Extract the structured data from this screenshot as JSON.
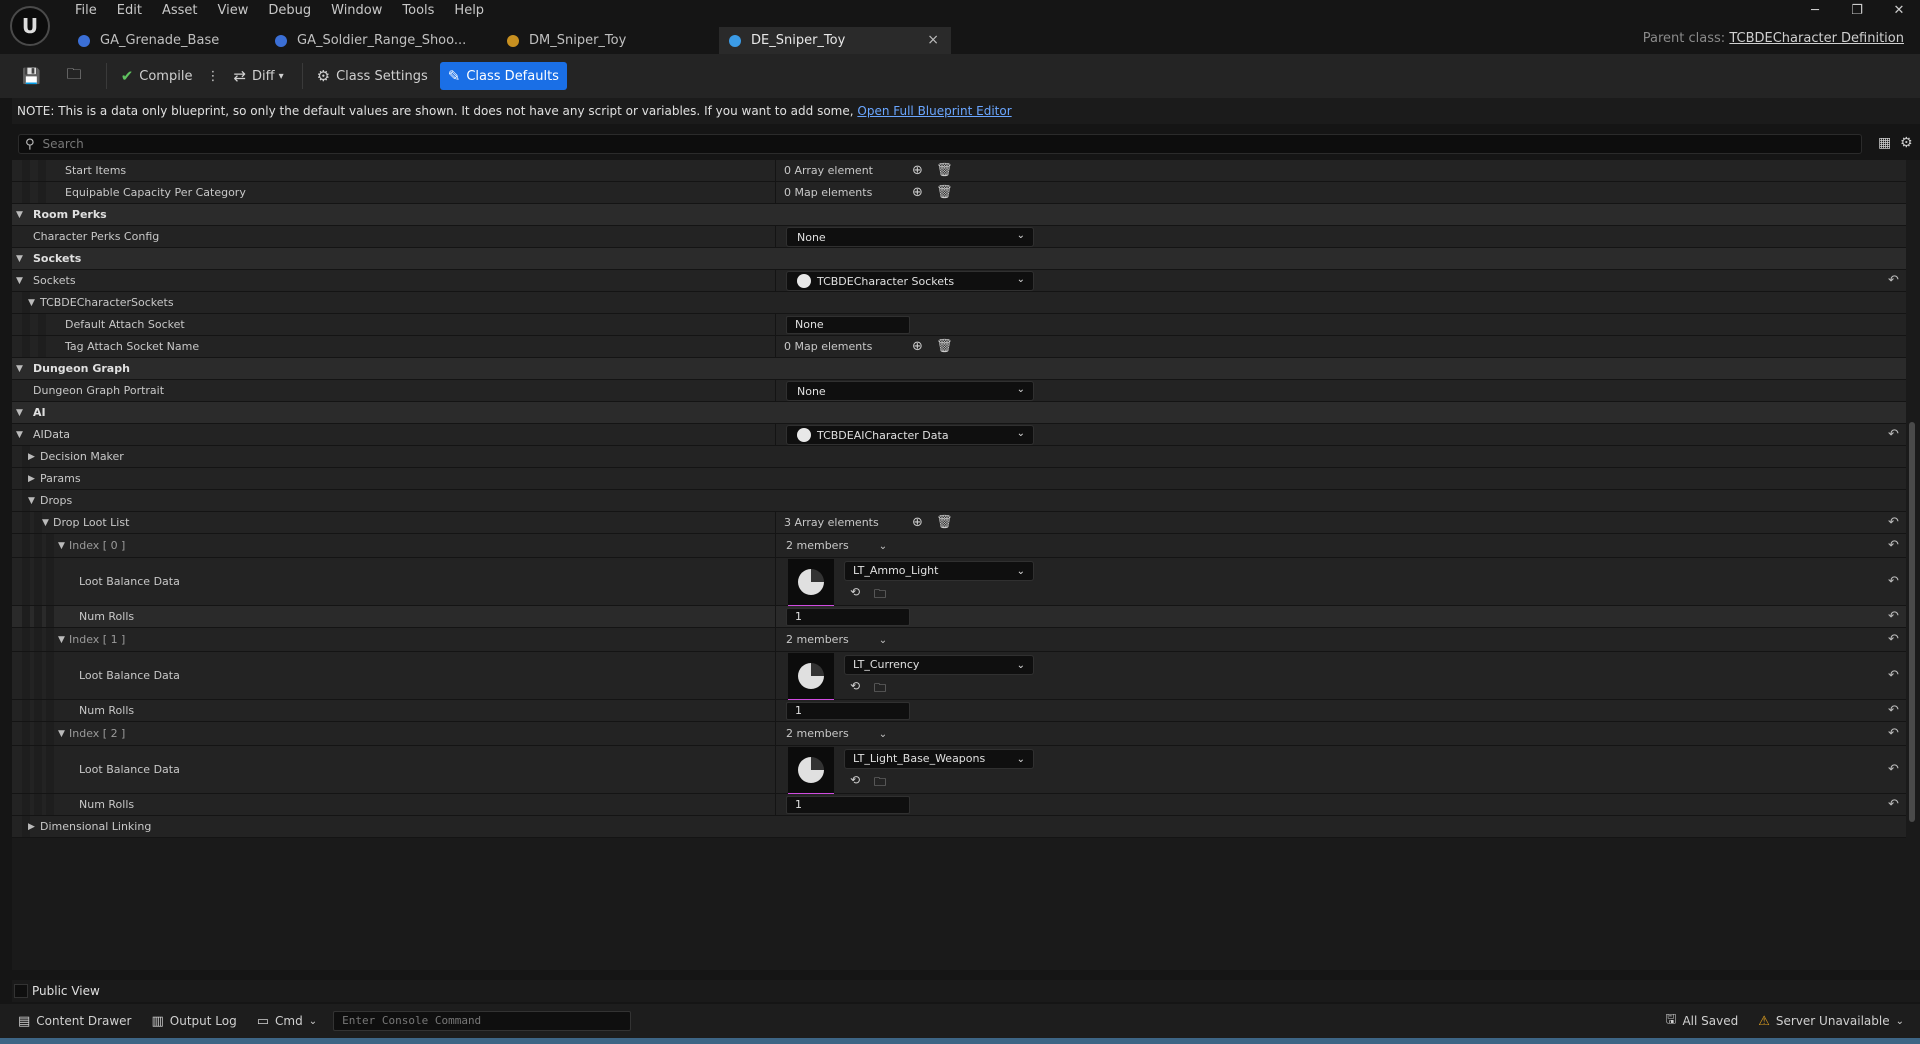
{
  "menu": [
    "File",
    "Edit",
    "Asset",
    "View",
    "Debug",
    "Window",
    "Tools",
    "Help"
  ],
  "tabs": [
    {
      "label": "GA_Grenade_Base",
      "color": "#3b6fd6"
    },
    {
      "label": "GA_Soldier_Range_Shoo...",
      "color": "#3b6fd6"
    },
    {
      "label": "DM_Sniper_Toy",
      "color": "#c89020"
    },
    {
      "label": "DE_Sniper_Toy",
      "color": "#3b9be6"
    }
  ],
  "tab_close_glyph": "×",
  "parent_class": {
    "label": "Parent class:",
    "value": "TCBDECharacter Definition"
  },
  "toolbar": {
    "compile": "Compile",
    "diff": "Diff",
    "class_settings": "Class Settings",
    "class_defaults": "Class Defaults"
  },
  "note": {
    "text": "NOTE: This is a data only blueprint, so only the default values are shown.  It does not have any script or variables.  If you want to add some,",
    "link": "Open Full Blueprint Editor"
  },
  "search": {
    "placeholder": "Search"
  },
  "rows": {
    "start_items": {
      "name": "Start Items",
      "value": "0 Array element"
    },
    "equip_cap": {
      "name": "Equipable Capacity Per Category",
      "value": "0 Map elements"
    },
    "room_perks": "Room Perks",
    "char_perks": {
      "name": "Character Perks Config",
      "value": "None"
    },
    "sockets_cat": "Sockets",
    "sockets": {
      "name": "Sockets",
      "value": "TCBDECharacter Sockets"
    },
    "tcbde_sockets": "TCBDECharacterSockets",
    "default_attach": {
      "name": "Default Attach Socket",
      "value": "None"
    },
    "tag_attach": {
      "name": "Tag Attach Socket Name",
      "value": "0 Map elements"
    },
    "dungeon_graph": "Dungeon Graph",
    "dungeon_portrait": {
      "name": "Dungeon Graph Portrait",
      "value": "None"
    },
    "ai": "AI",
    "aidata": {
      "name": "AIData",
      "value": "TCBDEAICharacter Data"
    },
    "decision_maker": "Decision Maker",
    "params": "Params",
    "drops": "Drops",
    "drop_loot_list": {
      "name": "Drop Loot List",
      "value": "3 Array elements"
    },
    "dimensional": "Dimensional Linking"
  },
  "loot_entries": [
    {
      "index": "Index [ 0 ]",
      "members": "2 members",
      "loot_label": "Loot Balance Data",
      "loot_value": "LT_Ammo_Light",
      "rolls_label": "Num Rolls",
      "rolls": "1"
    },
    {
      "index": "Index [ 1 ]",
      "members": "2 members",
      "loot_label": "Loot Balance Data",
      "loot_value": "LT_Currency",
      "rolls_label": "Num Rolls",
      "rolls": "1"
    },
    {
      "index": "Index [ 2 ]",
      "members": "2 members",
      "loot_label": "Loot Balance Data",
      "loot_value": "LT_Light_Base_Weapons",
      "rolls_label": "Num Rolls",
      "rolls": "1"
    }
  ],
  "public_view": "Public View",
  "status": {
    "content_drawer": "Content Drawer",
    "output_log": "Output Log",
    "cmd": "Cmd",
    "console_placeholder": "Enter Console Command",
    "all_saved": "All Saved",
    "server": "Server Unavailable"
  }
}
